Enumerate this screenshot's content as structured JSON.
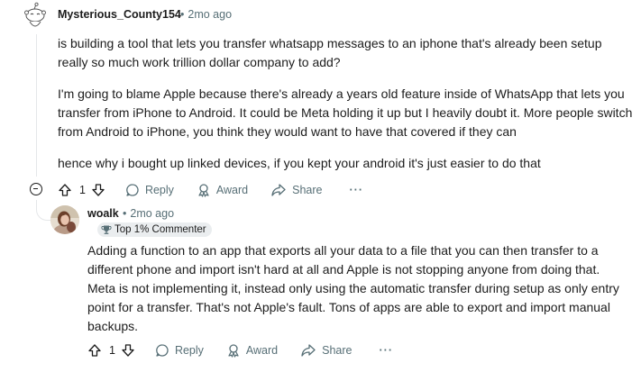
{
  "comment1": {
    "author": "Mysterious_County154",
    "time": "2mo ago",
    "paragraphs": [
      "is building a tool that lets you transfer whatsapp messages to an iphone that's already been setup really so much work trillion dollar company to add?",
      "I'm going to blame Apple because there's already a years old feature inside of WhatsApp that lets you transfer from iPhone to Android. It could be Meta holding it up but I heavily doubt it. More people switch from Android to iPhone, you think they would want to have that covered if they can",
      "hence why i bought up linked devices, if you kept your android it's just easier to do that"
    ],
    "votes": "1",
    "reply_label": "Reply",
    "award_label": "Award",
    "share_label": "Share",
    "more_label": "···"
  },
  "comment2": {
    "author": "woalk",
    "time": "2mo ago",
    "flair": "Top 1% Commenter",
    "paragraphs": [
      "Adding a function to an app that exports all your data to a file that you can then transfer to a different phone and import isn't hard at all and Apple is not stopping anyone from doing that. Meta is not implementing it, instead only using the automatic transfer during setup as only entry point for a transfer. That's not Apple's fault. Tons of apps are able to export and import manual backups."
    ],
    "votes": "1",
    "reply_label": "Reply",
    "award_label": "Award",
    "share_label": "Share",
    "more_label": "···"
  },
  "colors": {
    "text": "#1c1c1c",
    "meta": "#576f76",
    "flair_bg": "#eaedef",
    "thread_line": "#e5e7e9"
  }
}
